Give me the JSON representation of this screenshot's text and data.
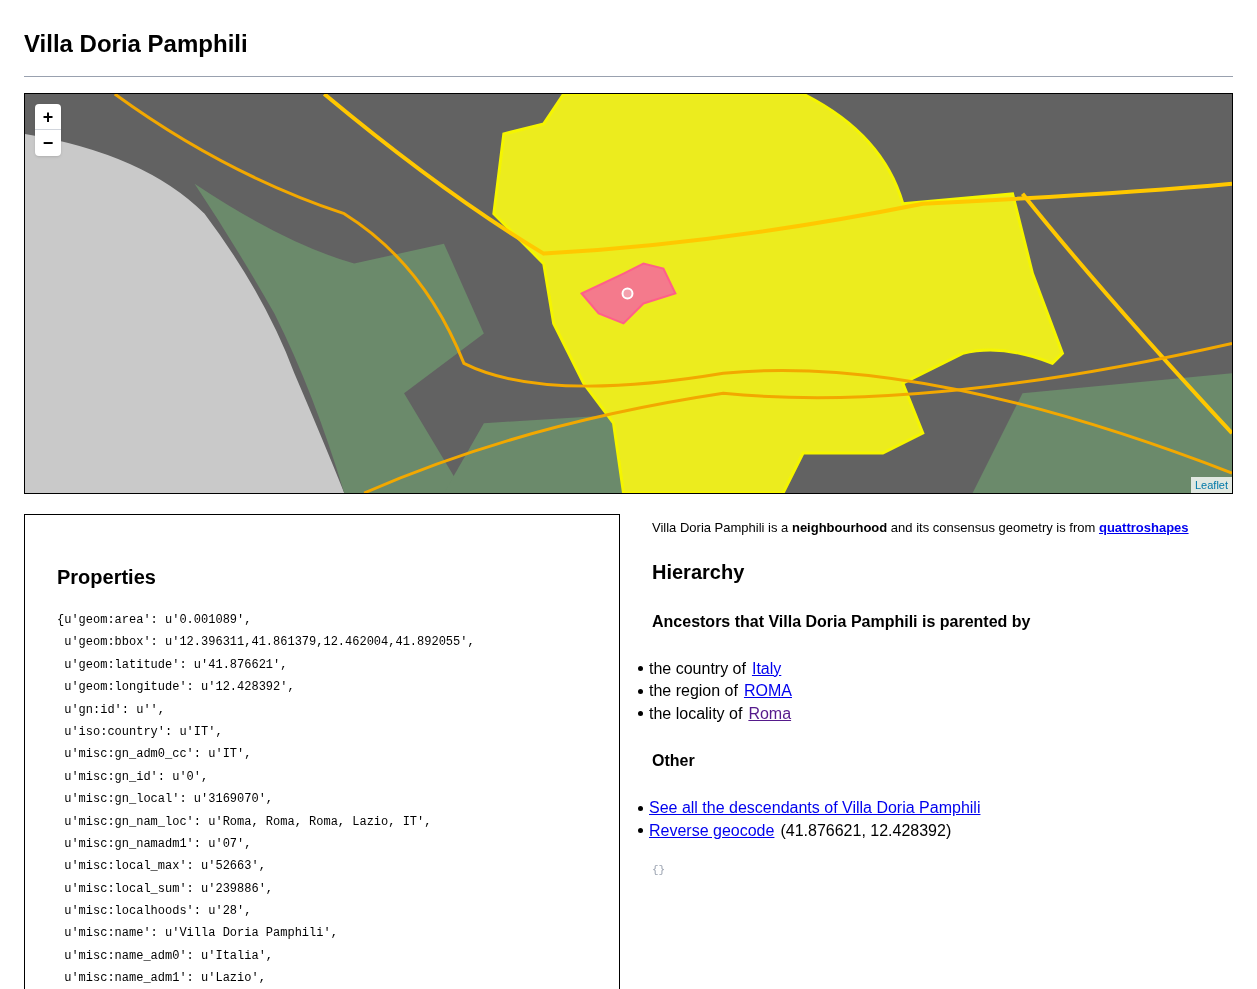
{
  "title": "Villa Doria Pamphili",
  "map": {
    "zoom_in": "+",
    "zoom_out": "−",
    "attribution": "Leaflet"
  },
  "properties": {
    "heading": "Properties",
    "lines": [
      "{u'geom:area': u'0.001089',",
      " u'geom:bbox': u'12.396311,41.861379,12.462004,41.892055',",
      " u'geom:latitude': u'41.876621',",
      " u'geom:longitude': u'12.428392',",
      " u'gn:id': u'',",
      " u'iso:country': u'IT',",
      " u'misc:gn_adm0_cc': u'IT',",
      " u'misc:gn_id': u'0',",
      " u'misc:gn_local': u'3169070',",
      " u'misc:gn_nam_loc': u'Roma, Roma, Roma, Lazio, IT',",
      " u'misc:gn_namadm1': u'07',",
      " u'misc:local_max': u'52663',",
      " u'misc:local_sum': u'239886',",
      " u'misc:localhoods': u'28',",
      " u'misc:name': u'Villa Doria Pamphili',",
      " u'misc:name_adm0': u'Italia',",
      " u'misc:name_adm1': u'Lazio',"
    ]
  },
  "summary": {
    "text": "Villa Doria Pamphili is a **neighbourhood** and its consensus geometry is from",
    "link": "quattroshapes"
  },
  "hierarchy": {
    "heading": "Hierarchy",
    "subheading": "Ancestors that Villa Doria Pamphili is parented by",
    "ancestors": [
      {
        "prefix": "the country of",
        "link": "Italy",
        "visited": false
      },
      {
        "prefix": "the region of",
        "link": "ROMA",
        "visited": false
      },
      {
        "prefix": "the locality of",
        "link": "Roma",
        "visited": true
      }
    ]
  },
  "other": {
    "heading": "Other",
    "items": [
      {
        "link": "See all the descendants of Villa Doria Pamphili"
      },
      {
        "link": "Reverse geocode",
        "suffix": "(41.876621, 12.428392)"
      }
    ]
  },
  "json_block": "{}"
}
